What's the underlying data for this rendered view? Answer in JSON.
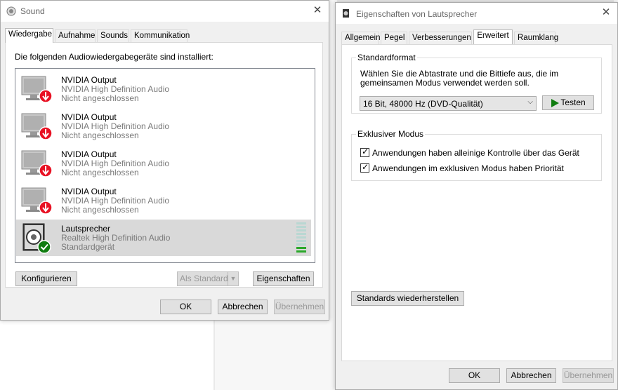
{
  "sound": {
    "title": "Sound",
    "tabs": [
      "Wiedergabe",
      "Aufnahme",
      "Sounds",
      "Kommunikation"
    ],
    "instruction": "Die folgenden Audiowiedergabegeräte sind installiert:",
    "devices": [
      {
        "name": "NVIDIA Output",
        "driver": "NVIDIA High Definition Audio",
        "status": "Nicht angeschlossen",
        "icon": "monitor-disconnected-icon"
      },
      {
        "name": "NVIDIA Output",
        "driver": "NVIDIA High Definition Audio",
        "status": "Nicht angeschlossen",
        "icon": "monitor-disconnected-icon"
      },
      {
        "name": "NVIDIA Output",
        "driver": "NVIDIA High Definition Audio",
        "status": "Nicht angeschlossen",
        "icon": "monitor-disconnected-icon"
      },
      {
        "name": "NVIDIA Output",
        "driver": "NVIDIA High Definition Audio",
        "status": "Nicht angeschlossen",
        "icon": "monitor-disconnected-icon"
      },
      {
        "name": "Lautsprecher",
        "driver": "Realtek High Definition Audio",
        "status": "Standardgerät",
        "icon": "speaker-default-icon",
        "selected": true
      }
    ],
    "buttons": {
      "configure": "Konfigurieren",
      "set_default": "Als Standard",
      "properties": "Eigenschaften",
      "ok": "OK",
      "cancel": "Abbrechen",
      "apply": "Übernehmen"
    }
  },
  "props": {
    "title": "Eigenschaften von Lautsprecher",
    "tabs": [
      "Allgemein",
      "Pegel",
      "Verbesserungen",
      "Erweitert",
      "Raumklang"
    ],
    "active_tab": "Erweitert",
    "standard_format": {
      "label": "Standardformat",
      "description_line1": "Wählen Sie die Abtastrate und die Bittiefe aus, die im",
      "description_line2": "gemeinsamen Modus verwendet werden soll.",
      "selected_format": "16 Bit, 48000 Hz (DVD-Qualität)",
      "test_button": "Testen"
    },
    "exclusive_mode": {
      "label": "Exklusiver Modus",
      "option1": "Anwendungen haben alleinige Kontrolle über das Gerät",
      "option1_checked": true,
      "option2": "Anwendungen im exklusiven Modus haben Priorität",
      "option2_checked": true
    },
    "restore_button": "Standards wiederherstellen",
    "buttons": {
      "ok": "OK",
      "cancel": "Abbrechen",
      "apply": "Übernehmen"
    }
  },
  "colors": {
    "accent_green": "#107c10",
    "disconnect_red": "#e81123"
  }
}
